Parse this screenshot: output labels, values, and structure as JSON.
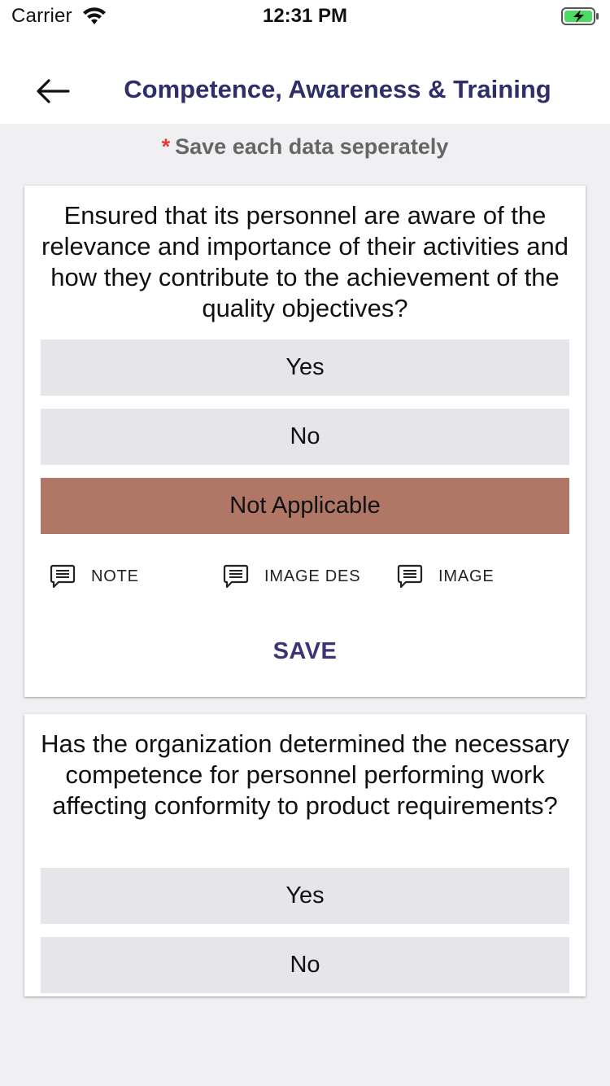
{
  "status_bar": {
    "carrier": "Carrier",
    "time": "12:31 PM"
  },
  "header": {
    "title": "Competence, Awareness & Training"
  },
  "hint": {
    "star": "*",
    "text": "Save each data seperately"
  },
  "cards": [
    {
      "question": "Ensured that its personnel are aware of the relevance and importance of their activities and how they contribute to the achievement of the quality objectives?",
      "options": [
        "Yes",
        "No",
        "Not Applicable"
      ],
      "selected": "Not Applicable",
      "actions": [
        "NOTE",
        "IMAGE DES",
        "IMAGE"
      ],
      "save_label": "SAVE"
    },
    {
      "question": "Has the organization determined the necessary competence for personnel performing work affecting conformity to product requirements?",
      "options": [
        "Yes",
        "No"
      ]
    }
  ],
  "colors": {
    "selected": "#b07766",
    "option": "#e5e5ea",
    "title": "#2f2d6a",
    "accent_star": "#e53935"
  }
}
